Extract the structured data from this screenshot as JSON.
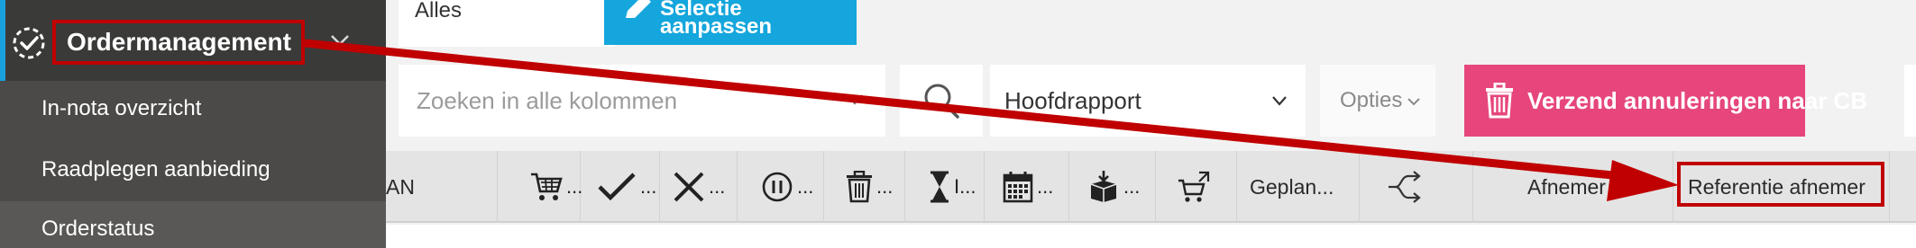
{
  "sidebar": {
    "title": "Ordermanagement",
    "items": [
      {
        "label": "In-nota overzicht"
      },
      {
        "label": "Raadplegen aanbieding"
      },
      {
        "label": "Orderstatus"
      }
    ]
  },
  "toolbar": {
    "filter_value": "Alles",
    "selectie_label": "Selectie aanpassen",
    "search_placeholder": "Zoeken in alle kolommen",
    "report_value": "Hoofdrapport",
    "opties_label": "Opties",
    "cancel_label": "Verzend annuleringen naar CB"
  },
  "columns": {
    "ean_partial": "AN",
    "hourglass_partial": "I...",
    "gepland": "Geplan...",
    "afnemer": "Afnemer",
    "referentie": "Referentie afnemer",
    "ellipsis": "..."
  },
  "colors": {
    "sidebar_bg": "#4b4a48",
    "accent_blue": "#14a6dc",
    "cancel_pink": "#e6467c",
    "annotation_red": "#c00000"
  }
}
